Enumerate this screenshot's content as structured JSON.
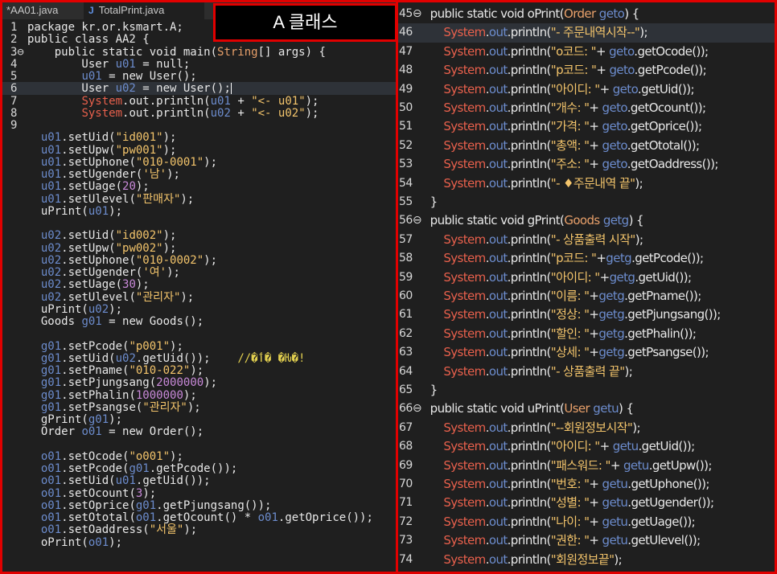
{
  "tabs": [
    {
      "label": "*AA01.java",
      "icon": ""
    },
    {
      "label": "TotalPrint.java",
      "icon": "J"
    }
  ],
  "title_overlay": "A 클래스",
  "left_code": [
    {
      "n": "1",
      "t": "package kr.or.ksmart.A;"
    },
    {
      "n": "2",
      "t": "public class AA2 {"
    },
    {
      "n": "3⊖",
      "t": "    public static void main(String[] args) {"
    },
    {
      "n": "4",
      "t": "        User u01 = null;"
    },
    {
      "n": "5",
      "t": "        u01 = new User();"
    },
    {
      "n": "6",
      "t": "        User u02 = new User();"
    },
    {
      "n": "7",
      "t": "        System.out.println(u01 + \"<- u01\");"
    },
    {
      "n": "8",
      "t": "        System.out.println(u02 + \"<- u02\");"
    },
    {
      "n": "9",
      "t": ""
    },
    {
      "n": "",
      "t": "    u01.setUid(\"id001\");"
    },
    {
      "n": "",
      "t": "    u01.setUpw(\"pw001\");"
    },
    {
      "n": "",
      "t": "    u01.setUphone(\"010-0001\");"
    },
    {
      "n": "",
      "t": "    u01.setUgender('남');"
    },
    {
      "n": "",
      "t": "    u01.setUage(20);"
    },
    {
      "n": "",
      "t": "    u01.setUlevel(\"판매자\");"
    },
    {
      "n": "",
      "t": "    uPrint(u01);"
    },
    {
      "n": "",
      "t": ""
    },
    {
      "n": "",
      "t": "    u02.setUid(\"id002\");"
    },
    {
      "n": "",
      "t": "    u02.setUpw(\"pw002\");"
    },
    {
      "n": "",
      "t": "    u02.setUphone(\"010-0002\");"
    },
    {
      "n": "",
      "t": "    u02.setUgender('여');"
    },
    {
      "n": "",
      "t": "    u02.setUage(30);"
    },
    {
      "n": "",
      "t": "    u02.setUlevel(\"관리자\");"
    },
    {
      "n": "",
      "t": "    uPrint(u02);"
    },
    {
      "n": "",
      "t": "    Goods g01 = new Goods();"
    },
    {
      "n": "",
      "t": ""
    },
    {
      "n": "",
      "t": "    g01.setPcode(\"p001\");"
    },
    {
      "n": "",
      "t": "    g01.setUid(u02.getUid());    //�ٲ� �Ƕ�!"
    },
    {
      "n": "",
      "t": "    g01.setPname(\"010-022\");"
    },
    {
      "n": "",
      "t": "    g01.setPjungsang(2000000);"
    },
    {
      "n": "",
      "t": "    g01.setPhalin(1000000);"
    },
    {
      "n": "",
      "t": "    g01.setPsangse(\"관리자\");"
    },
    {
      "n": "",
      "t": "    gPrint(g01);"
    },
    {
      "n": "",
      "t": "    Order o01 = new Order();"
    },
    {
      "n": "",
      "t": ""
    },
    {
      "n": "",
      "t": "    o01.setOcode(\"o001\");"
    },
    {
      "n": "",
      "t": "    o01.setPcode(g01.getPcode());"
    },
    {
      "n": "",
      "t": "    o01.setUid(u01.getUid());"
    },
    {
      "n": "",
      "t": "    o01.setOcount(3);"
    },
    {
      "n": "",
      "t": "    o01.setOprice(g01.getPjungsang());"
    },
    {
      "n": "",
      "t": "    o01.setOtotal(o01.getOcount() * o01.getOprice());"
    },
    {
      "n": "",
      "t": "    o01.setOaddress(\"서울\");"
    },
    {
      "n": "",
      "t": "    oPrint(o01);"
    }
  ],
  "right_code": [
    {
      "n": "45⊖",
      "t": "    public static void oPrint(Order geto) {"
    },
    {
      "n": "46",
      "t": "        System.out.println(\"- 주문내역시작--\");"
    },
    {
      "n": "47",
      "t": "        System.out.println(\"o코드: \"+ geto.getOcode());"
    },
    {
      "n": "48",
      "t": "        System.out.println(\"p코드: \"+ geto.getPcode());"
    },
    {
      "n": "49",
      "t": "        System.out.println(\"아이디: \"+ geto.getUid());"
    },
    {
      "n": "50",
      "t": "        System.out.println(\"개수: \"+ geto.getOcount());"
    },
    {
      "n": "51",
      "t": "        System.out.println(\"가격: \"+ geto.getOprice());"
    },
    {
      "n": "52",
      "t": "        System.out.println(\"총액: \"+ geto.getOtotal());"
    },
    {
      "n": "53",
      "t": "        System.out.println(\"주소: \"+ geto.getOaddress());"
    },
    {
      "n": "54",
      "t": "        System.out.println(\"- ♦주문내역 끝\");"
    },
    {
      "n": "55",
      "t": "    }"
    },
    {
      "n": "56⊖",
      "t": "    public static void gPrint(Goods getg) {"
    },
    {
      "n": "57",
      "t": "        System.out.println(\"- 상품출력 시작\");"
    },
    {
      "n": "58",
      "t": "        System.out.println(\"p코드: \"+getg.getPcode());"
    },
    {
      "n": "59",
      "t": "        System.out.println(\"아이디: \"+getg.getUid());"
    },
    {
      "n": "60",
      "t": "        System.out.println(\"이름: \"+getg.getPname());"
    },
    {
      "n": "61",
      "t": "        System.out.println(\"정상: \"+getg.getPjungsang());"
    },
    {
      "n": "62",
      "t": "        System.out.println(\"할인: \"+getg.getPhalin());"
    },
    {
      "n": "63",
      "t": "        System.out.println(\"상세: \"+getg.getPsangse());"
    },
    {
      "n": "64",
      "t": "        System.out.println(\"- 상품출력 끝\");"
    },
    {
      "n": "65",
      "t": "    }"
    },
    {
      "n": "66⊖",
      "t": "    public static void uPrint(User getu) {"
    },
    {
      "n": "67",
      "t": "        System.out.println(\"--회원정보시작\");"
    },
    {
      "n": "68",
      "t": "        System.out.println(\"아이디: \"+ getu.getUid());"
    },
    {
      "n": "69",
      "t": "        System.out.println(\"패스워드: \"+ getu.getUpw());"
    },
    {
      "n": "70",
      "t": "        System.out.println(\"번호: \"+ getu.getUphone());"
    },
    {
      "n": "71",
      "t": "        System.out.println(\"성별: \"+ getu.getUgender());"
    },
    {
      "n": "72",
      "t": "        System.out.println(\"나이: \"+ getu.getUage());"
    },
    {
      "n": "73",
      "t": "        System.out.println(\"권한: \"+ getu.getUlevel());"
    },
    {
      "n": "74",
      "t": "        System.out.println(\"회원정보끝\");"
    }
  ],
  "colors": {
    "frame": "#e10000",
    "background": "#1f1f1f",
    "string": "#f3c46b",
    "variable": "#6c8ccd",
    "system": "#e8604c",
    "type": "#e8a06a",
    "number": "#c889d8"
  }
}
